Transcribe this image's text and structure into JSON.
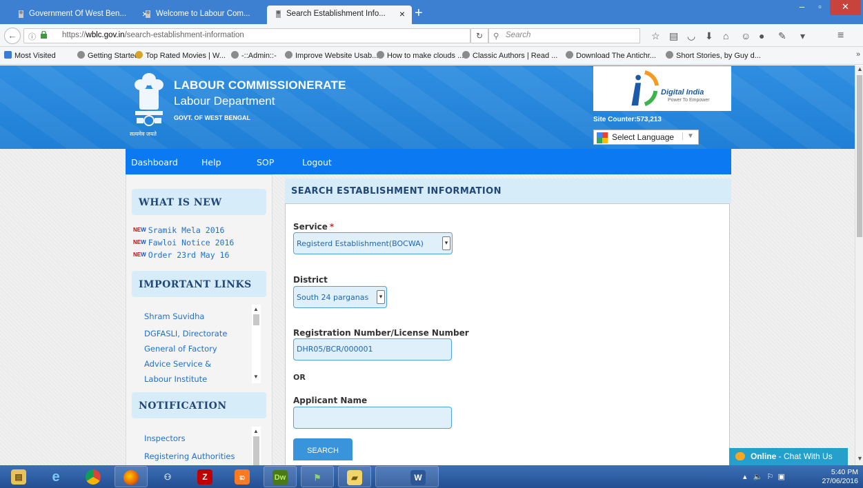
{
  "browser": {
    "tabs": [
      {
        "title": "Government Of West Ben...",
        "active": false
      },
      {
        "title": "Welcome to Labour Com...",
        "active": false
      },
      {
        "title": "Search Establishment Info...",
        "active": true
      }
    ],
    "url_prefix": "https://",
    "url_host": "wblc.gov.in",
    "url_path": "/search-establishment-information",
    "search_placeholder": "Search",
    "bookmarks": [
      "Most Visited",
      "Getting Started",
      "Top Rated Movies | W...",
      "-::Admin::-",
      "Improve Website Usab...",
      "How to make clouds ...",
      "Classic Authors | Read ...",
      "Download The Antichr...",
      "Short Stories, by Guy d..."
    ]
  },
  "site": {
    "title": "LABOUR COMMISSIONERATE",
    "subtitle": "Labour Department",
    "gov": "GOVT. OF WEST BENGAL",
    "motto": "सत्यमेव जयते",
    "digital_india": "Digital India",
    "digital_india_tag": "Power To Empower",
    "site_counter": "Site Counter:573,213",
    "language_select": "Select Language",
    "nav": [
      "Dashboard",
      "Help",
      "SOP",
      "Logout"
    ]
  },
  "sidebar": {
    "whats_new_title": "WHAT IS NEW",
    "new_badge": "NEW",
    "whats_new": [
      "Sramik Mela 2016",
      "Fawloi Notice 2016",
      "Order 23rd May 16"
    ],
    "important_links_title": "IMPORTANT LINKS",
    "important_links": [
      "Shram Suvidha",
      "DGFASLI, Directorate",
      "General of Factory",
      "Advice Service &",
      "Labour Institute"
    ],
    "notification_title": "NOTIFICATION",
    "notifications": [
      "Inspectors",
      "Registering Authorities"
    ]
  },
  "form": {
    "heading": "SEARCH ESTABLISHMENT INFORMATION",
    "service_label": "Service",
    "required_mark": "*",
    "service_value": "Registerd Establishment(BOCWA)",
    "district_label": "District",
    "district_value": "South 24 parganas",
    "reg_label": "Registration Number/License Number",
    "reg_value": "DHR05/BCR/000001",
    "or_label": "OR",
    "applicant_label": "Applicant Name",
    "applicant_value": "",
    "search_button": "SEARCH"
  },
  "chat": {
    "status": "Online",
    "label": " - Chat With Us"
  },
  "taskbar": {
    "apps": [
      "file-explorer",
      "internet-explorer",
      "chrome",
      "firefox",
      "pgadmin",
      "filezilla",
      "xampp",
      "dreamweaver",
      "network-tool",
      "folder",
      "word"
    ],
    "time": "5:40 PM",
    "date": "27/06/2016"
  },
  "colors": {
    "header_blue": "#2f8ee0",
    "nav_blue": "#0b79f2",
    "heading_bg": "#d6ecf8",
    "link_blue": "#1e6fd0",
    "close_red": "#c7433b"
  }
}
